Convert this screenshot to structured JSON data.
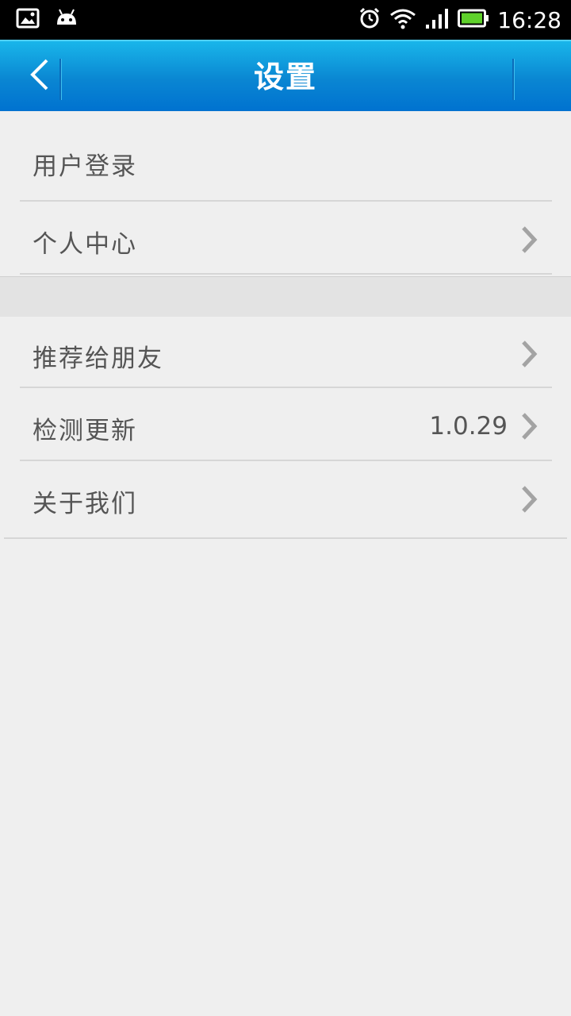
{
  "status_bar": {
    "time": "16:28",
    "icons": [
      "image-icon",
      "android-icon",
      "alarm-icon",
      "wifi-icon",
      "signal-icon",
      "battery-icon"
    ]
  },
  "header": {
    "title": "设置",
    "back_icon": "chevron-left-icon"
  },
  "menu": {
    "group1": [
      {
        "label": "用户登录"
      },
      {
        "label": "个人中心"
      }
    ],
    "group2": [
      {
        "label": "推荐给朋友"
      },
      {
        "label": "检测更新",
        "value": "1.0.29"
      },
      {
        "label": "关于我们"
      }
    ]
  },
  "colors": {
    "accent": "#0a86d2",
    "background": "#efefef",
    "text": "#555555"
  }
}
